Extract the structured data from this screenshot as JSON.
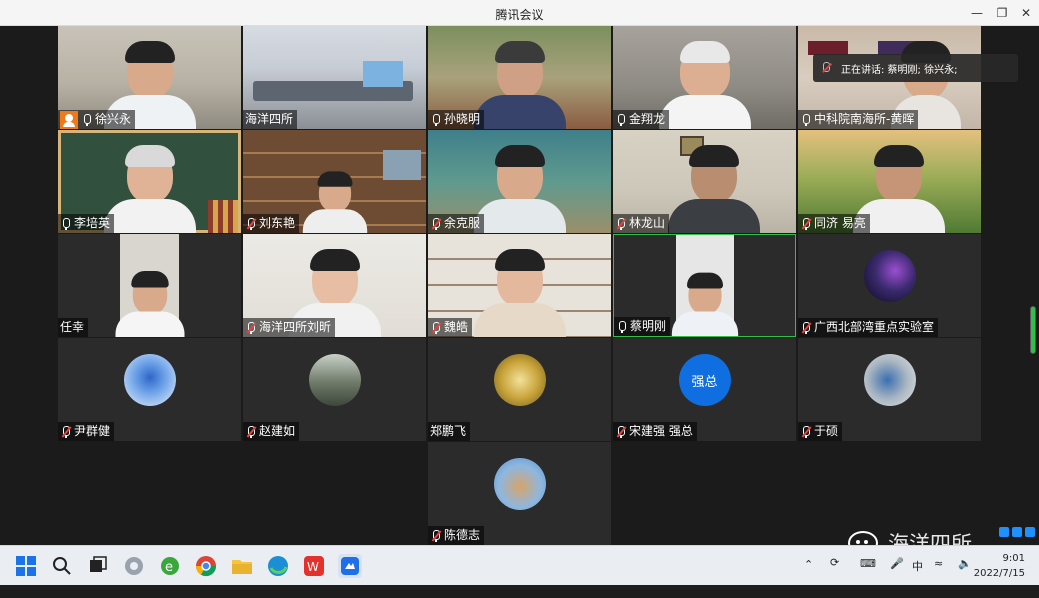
{
  "window": {
    "title": "腾讯会议"
  },
  "speaking": {
    "label": "正在讲话: 蔡明刚; 徐兴永;"
  },
  "participants": [
    {
      "name": "徐兴永",
      "host": true,
      "muted": false
    },
    {
      "name": "海洋四所",
      "host": false,
      "muted": null
    },
    {
      "name": "孙晓明",
      "host": false,
      "muted": false
    },
    {
      "name": "金翔龙",
      "host": false,
      "muted": false
    },
    {
      "name": "中科院南海所-黄晖",
      "host": false,
      "muted": false
    },
    {
      "name": "李培英",
      "host": false,
      "muted": false
    },
    {
      "name": "刘东艳",
      "host": false,
      "muted": true
    },
    {
      "name": "余克服",
      "host": false,
      "muted": true
    },
    {
      "name": "林龙山",
      "host": false,
      "muted": true
    },
    {
      "name": "同济 易亮",
      "host": false,
      "muted": true
    },
    {
      "name": "任幸",
      "host": false,
      "muted": null
    },
    {
      "name": "海洋四所刘昕",
      "host": false,
      "muted": true
    },
    {
      "name": "魏皓",
      "host": false,
      "muted": true
    },
    {
      "name": "蔡明刚",
      "host": false,
      "muted": false
    },
    {
      "name": "广西北部湾重点实验室",
      "host": false,
      "muted": true
    },
    {
      "name": "尹群健",
      "host": false,
      "muted": true
    },
    {
      "name": "赵建如",
      "host": false,
      "muted": true
    },
    {
      "name": "郑鹏飞",
      "host": false,
      "muted": null
    },
    {
      "name": "宋建强 强总",
      "host": false,
      "muted": true,
      "avatar_text": "强总"
    },
    {
      "name": "于硕",
      "host": false,
      "muted": true
    },
    {
      "name": "陈德志",
      "host": false,
      "muted": true
    }
  ],
  "watermark": {
    "text": "海洋四所"
  },
  "taskbar": {
    "clock_time": "9:01",
    "clock_date": "2022/7/15",
    "ime": "中",
    "apps": [
      "start-icon",
      "search-icon",
      "taskview-icon",
      "edge-old-icon",
      "ie-icon",
      "chrome-icon",
      "folder-icon",
      "edge-icon",
      "wps-icon",
      "tencent-meeting-icon"
    ]
  },
  "colors": {
    "accent": "#0f6fe0",
    "host_badge": "#f07a18",
    "muted_red": "#e64340",
    "level_green": "#2fc14a"
  }
}
